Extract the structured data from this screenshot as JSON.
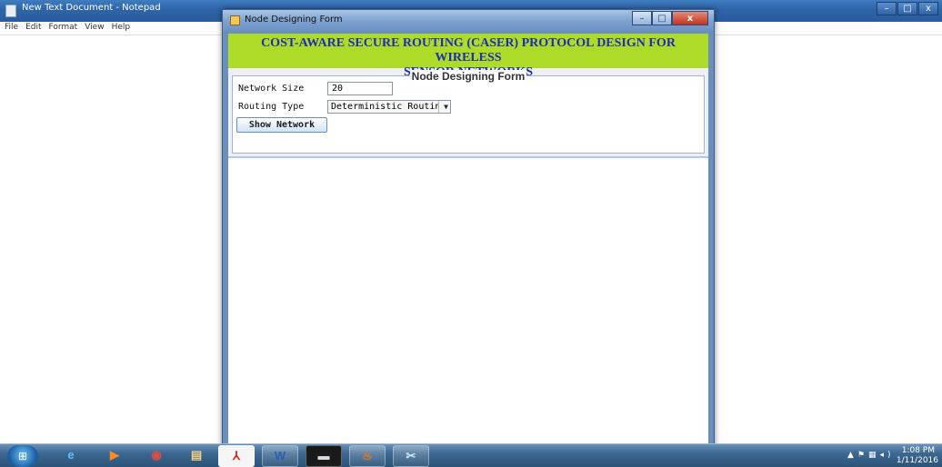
{
  "notepad": {
    "title": "New Text Document - Notepad",
    "menu": [
      "File",
      "Edit",
      "Format",
      "View",
      "Help"
    ],
    "controls": {
      "minimize": "–",
      "maximize": "□",
      "close": "x"
    }
  },
  "dialog": {
    "title": "Node Designing Form",
    "controls": {
      "minimize": "–",
      "maximize": "□",
      "close": "x"
    },
    "heading_line1": "COST-AWARE SECURE ROUTING (CASER) PROTOCOL DESIGN FOR WIRELESS",
    "heading_line2": "SENSOR NETWORKS",
    "form_legend": "Node Designing Form",
    "network_size_label": "Network Size",
    "network_size_value": "20",
    "routing_type_label": "Routing Type",
    "routing_type_value": "Deterministic Routing",
    "show_network_button": "Show Network",
    "heading_bg": "#aedb28",
    "heading_color": "#1e2db8"
  },
  "taskbar": {
    "apps": [
      "start-orb-icon",
      "internet-explorer-icon",
      "media-player-icon",
      "chrome-icon",
      "file-explorer-icon",
      "adobe-reader-icon",
      "word-icon",
      "command-prompt-icon",
      "java-icon",
      "snipping-tool-icon"
    ],
    "clock_time": "1:08 PM",
    "clock_date": "1/11/2016"
  }
}
